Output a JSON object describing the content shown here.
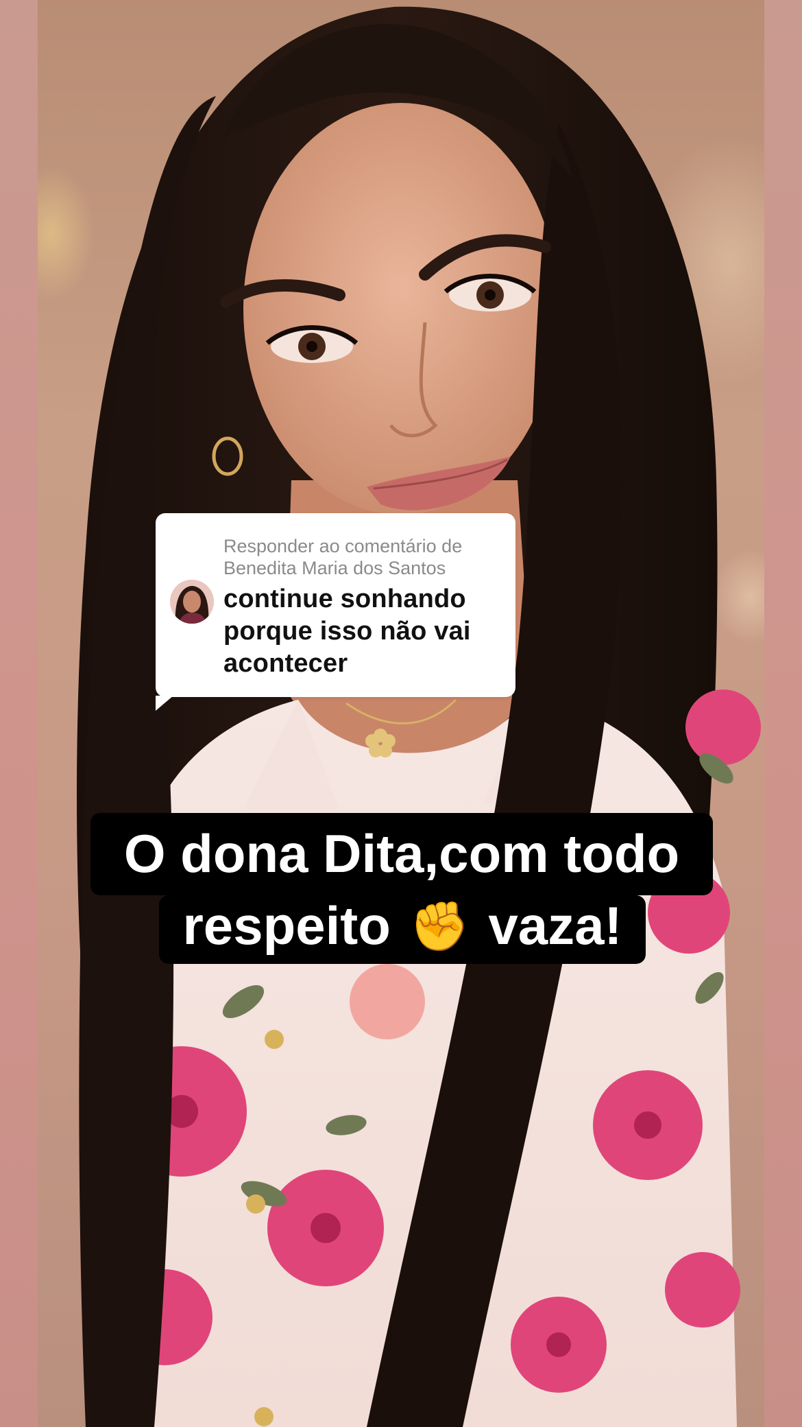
{
  "reply": {
    "header": "Responder ao comentário de Benedita Maria dos Santos",
    "comment": "continue sonhando porque isso não vai acontecer"
  },
  "caption": {
    "line1": "O dona Dita,com todo",
    "line2_before": "respeito",
    "line2_emoji": "✊",
    "line2_after": "vaza!"
  },
  "colors": {
    "side_bands": "#c9958d",
    "caption_background": "#000000",
    "caption_text": "#ffffff",
    "bubble_background": "#ffffff",
    "bubble_header_text": "#8a8a8a",
    "bubble_comment_text": "#111111",
    "blouse_flowers": "#e0457a"
  },
  "icons": [
    "raised-fist-icon",
    "commenter-avatar"
  ]
}
